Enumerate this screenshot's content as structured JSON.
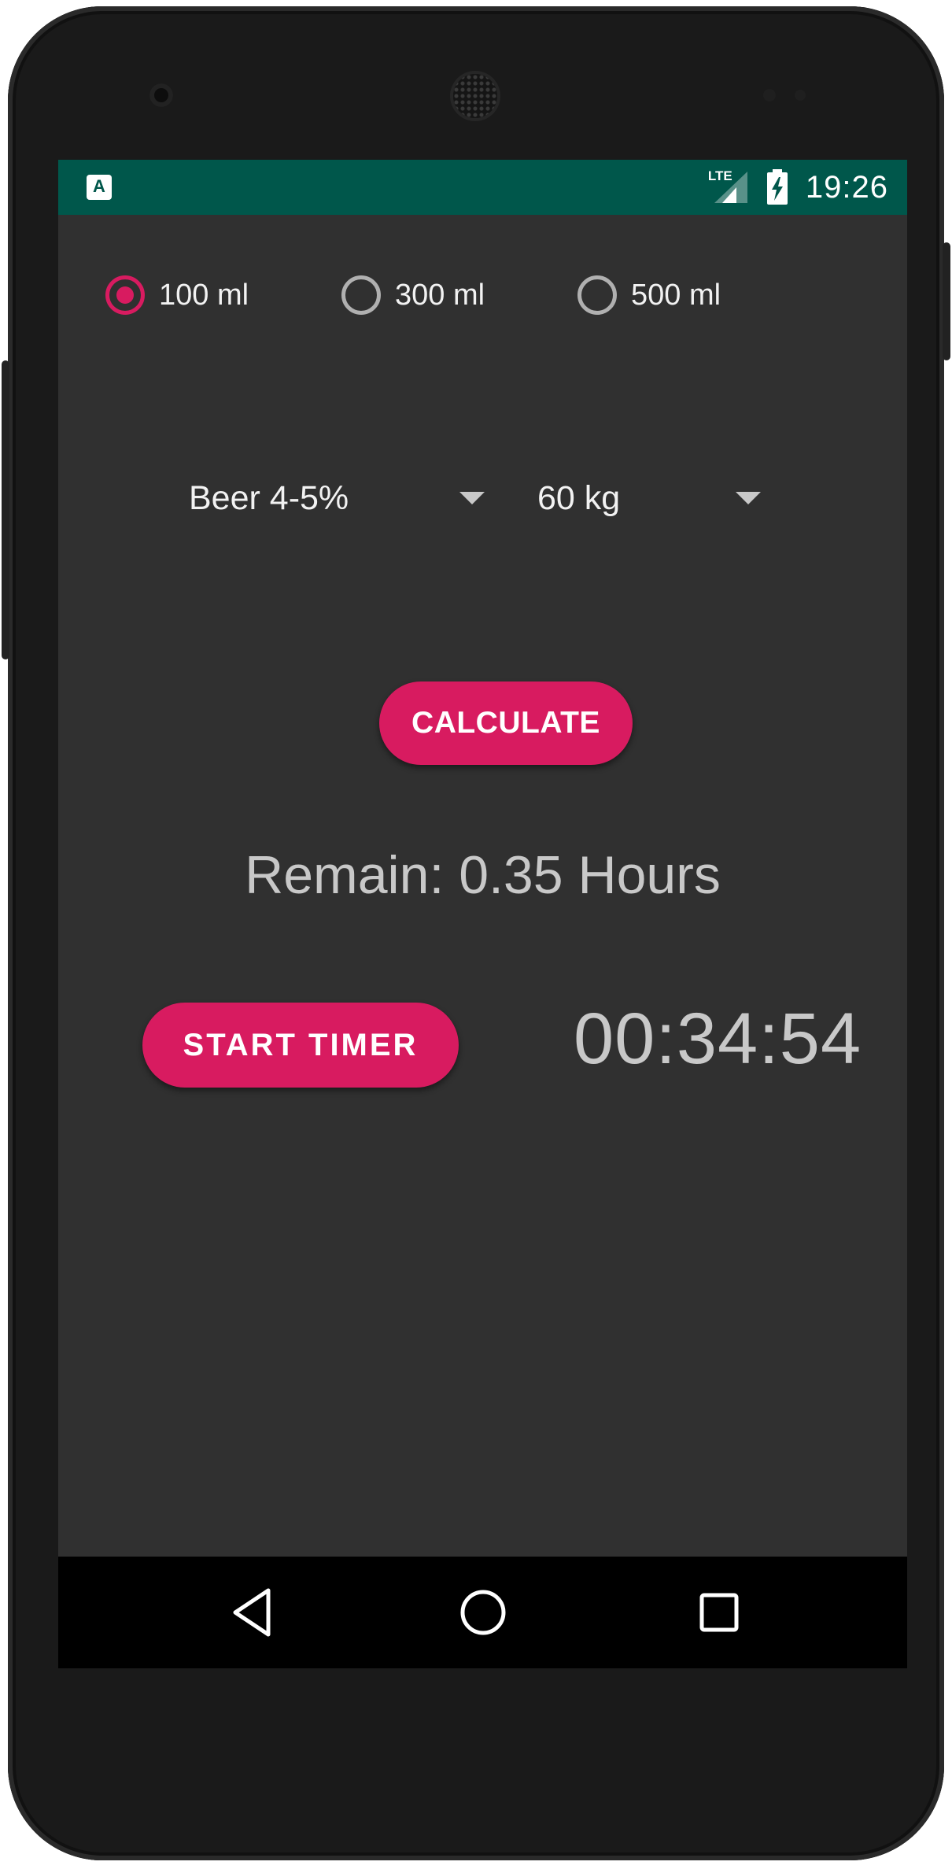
{
  "status_bar": {
    "app_icon_letter": "A",
    "network_label": "LTE",
    "time": "19:26",
    "background_color": "#00574b"
  },
  "volume_options": {
    "selected": "100 ml",
    "items": [
      {
        "label": "100 ml",
        "checked": true
      },
      {
        "label": "300 ml",
        "checked": false
      },
      {
        "label": "500 ml",
        "checked": false
      }
    ]
  },
  "drink_spinner": {
    "selected": "Beer 4-5%"
  },
  "weight_spinner": {
    "selected": "60 kg"
  },
  "calculate_button": {
    "label": "CALCULATE"
  },
  "result": {
    "text": "Remain: 0.35 Hours"
  },
  "start_timer_button": {
    "label": "START TIMER"
  },
  "timer": {
    "display": "00:34:54"
  },
  "colors": {
    "accent": "#d81b60",
    "screen_background": "#303030",
    "status_bar": "#00574b"
  },
  "icons": {
    "status": [
      "app-notification-icon",
      "lte-signal-icon",
      "battery-charging-icon"
    ],
    "nav": [
      "back-icon",
      "home-icon",
      "recents-icon"
    ]
  }
}
